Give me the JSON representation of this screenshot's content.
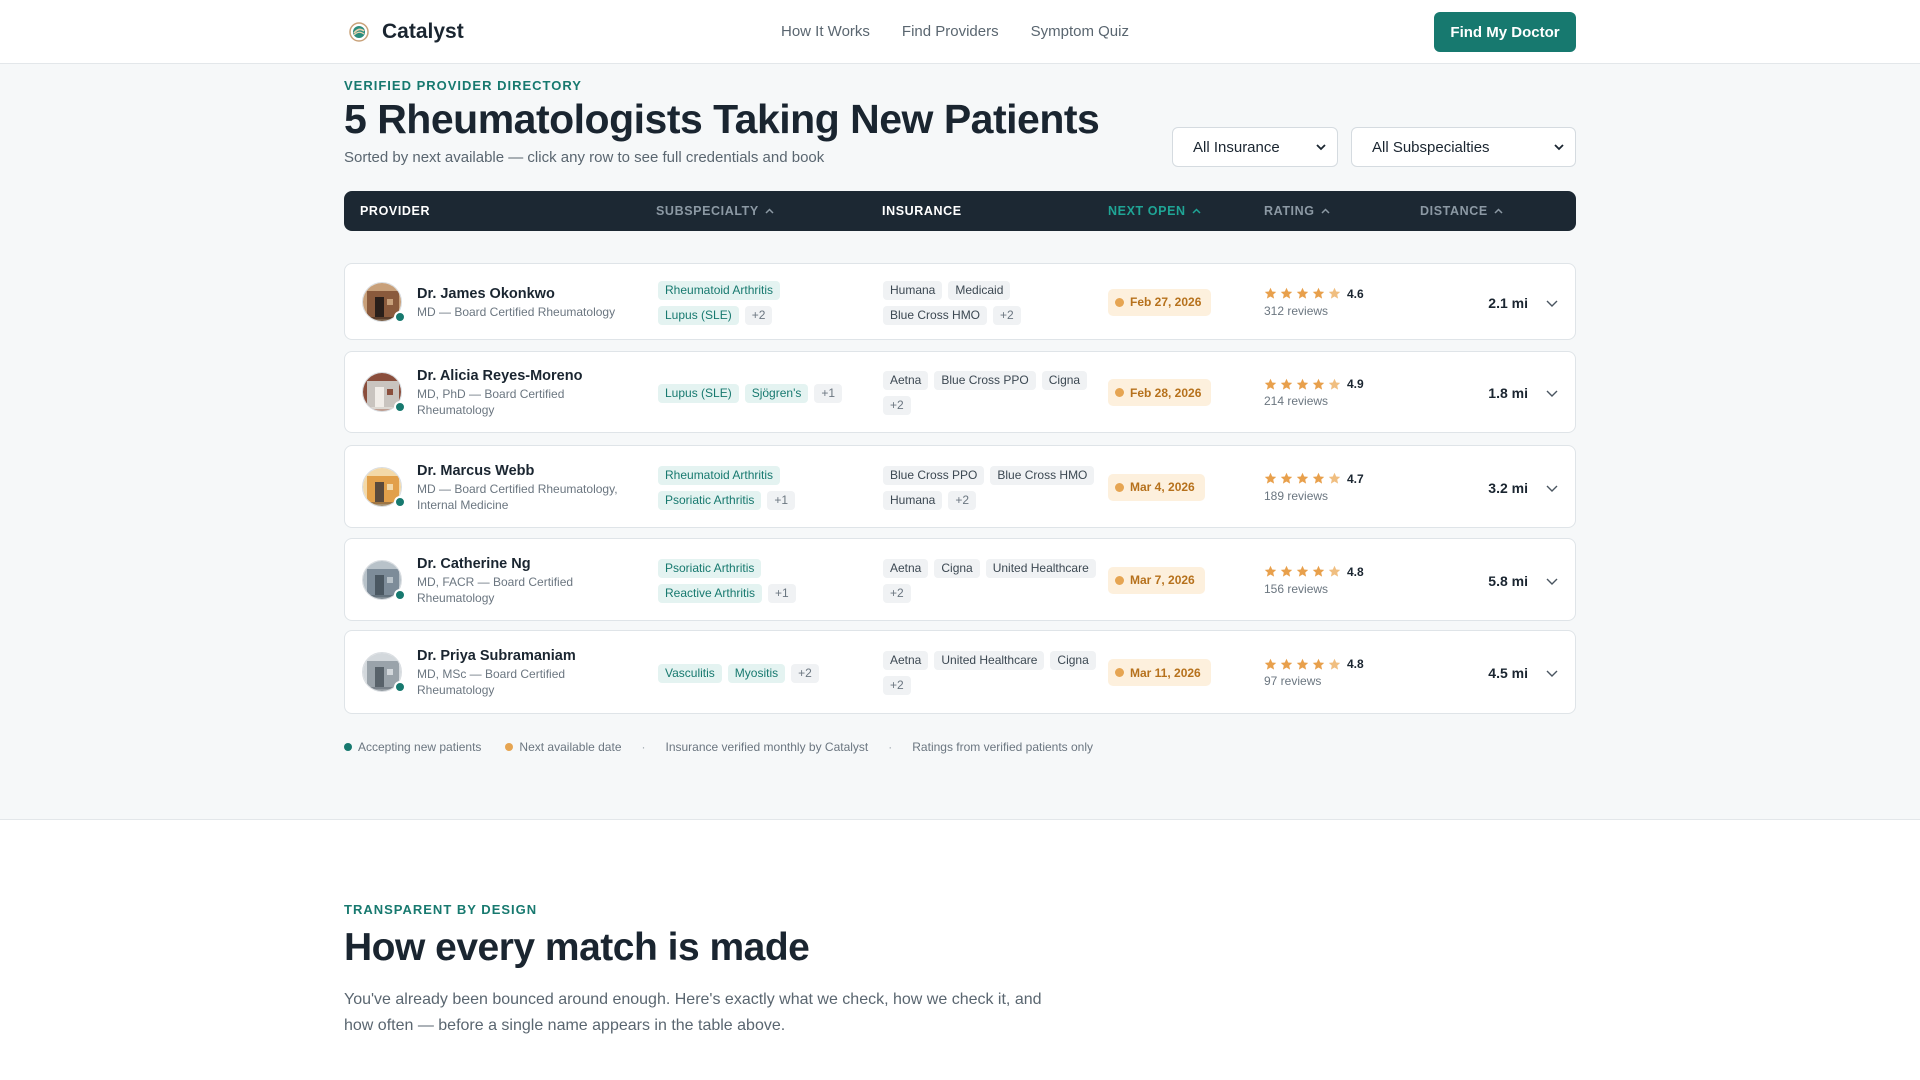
{
  "nav": {
    "brand": "Catalyst",
    "links": [
      "How It Works",
      "Find Providers",
      "Symptom Quiz"
    ],
    "cta": "Find My Doctor"
  },
  "header": {
    "eyebrow": "VERIFIED PROVIDER DIRECTORY",
    "title": "5 Rheumatologists Taking New Patients",
    "subtitle": "Sorted by next available — click any row to see full credentials and book"
  },
  "filters": {
    "insurance": "All Insurance",
    "subspecialty": "All Subspecialties"
  },
  "table": {
    "columns": [
      "PROVIDER",
      "SUBSPECIALTY",
      "INSURANCE",
      "NEXT OPEN",
      "RATING",
      "DISTANCE"
    ],
    "active_sort": "NEXT OPEN",
    "rows": [
      {
        "name": "Dr. James Okonkwo",
        "credentials": "MD — Board Certified Rheumatology",
        "subspecialties": [
          "Rheumatoid Arthritis",
          "Lupus (SLE)"
        ],
        "sub_more": "+2",
        "insurance": [
          "Humana",
          "Medicaid",
          "Blue Cross HMO"
        ],
        "ins_more": "+2",
        "next_open": "Feb 27, 2026",
        "rating": "4.6",
        "rating_value": 4.6,
        "reviews": "312 reviews",
        "distance": "2.1 mi"
      },
      {
        "name": "Dr. Alicia Reyes-Moreno",
        "credentials": "MD, PhD — Board Certified Rheumatology",
        "subspecialties": [
          "Lupus (SLE)",
          "Sjögren's"
        ],
        "sub_more": "+1",
        "insurance": [
          "Aetna",
          "Blue Cross PPO",
          "Cigna"
        ],
        "ins_more": "+2",
        "next_open": "Feb 28, 2026",
        "rating": "4.9",
        "rating_value": 4.9,
        "reviews": "214 reviews",
        "distance": "1.8 mi"
      },
      {
        "name": "Dr. Marcus Webb",
        "credentials": "MD — Board Certified Rheumatology, Internal Medicine",
        "subspecialties": [
          "Rheumatoid Arthritis",
          "Psoriatic Arthritis"
        ],
        "sub_more": "+1",
        "insurance": [
          "Blue Cross PPO",
          "Blue Cross HMO",
          "Humana"
        ],
        "ins_more": "+2",
        "next_open": "Mar 4, 2026",
        "rating": "4.7",
        "rating_value": 4.7,
        "reviews": "189 reviews",
        "distance": "3.2 mi"
      },
      {
        "name": "Dr. Catherine Ng",
        "credentials": "MD, FACR — Board Certified Rheumatology",
        "subspecialties": [
          "Psoriatic Arthritis",
          "Reactive Arthritis"
        ],
        "sub_more": "+1",
        "insurance": [
          "Aetna",
          "Cigna",
          "United Healthcare"
        ],
        "ins_more": "+2",
        "next_open": "Mar 7, 2026",
        "rating": "4.8",
        "rating_value": 4.8,
        "reviews": "156 reviews",
        "distance": "5.8 mi"
      },
      {
        "name": "Dr. Priya Subramaniam",
        "credentials": "MD, MSc — Board Certified Rheumatology",
        "subspecialties": [
          "Vasculitis",
          "Myositis"
        ],
        "sub_more": "+2",
        "insurance": [
          "Aetna",
          "United Healthcare",
          "Cigna"
        ],
        "ins_more": "+2",
        "next_open": "Mar 11, 2026",
        "rating": "4.8",
        "rating_value": 4.8,
        "reviews": "97 reviews",
        "distance": "4.5 mi"
      }
    ]
  },
  "legend": {
    "accepting": "Accepting new patients",
    "next_available": "Next available date",
    "insurance_note": "Insurance verified monthly by Catalyst",
    "ratings_note": "Ratings from verified patients only"
  },
  "section2": {
    "eyebrow": "TRANSPARENT BY DESIGN",
    "title": "How every match is made",
    "body": "You've already been bounced around enough. Here's exactly what we check, how we check it, and how often — before a single name appears in the table above."
  },
  "colors": {
    "accent": "#17796f",
    "header_bg": "#1c2833",
    "amber": "#e6a552",
    "star": "#e8a04c"
  }
}
